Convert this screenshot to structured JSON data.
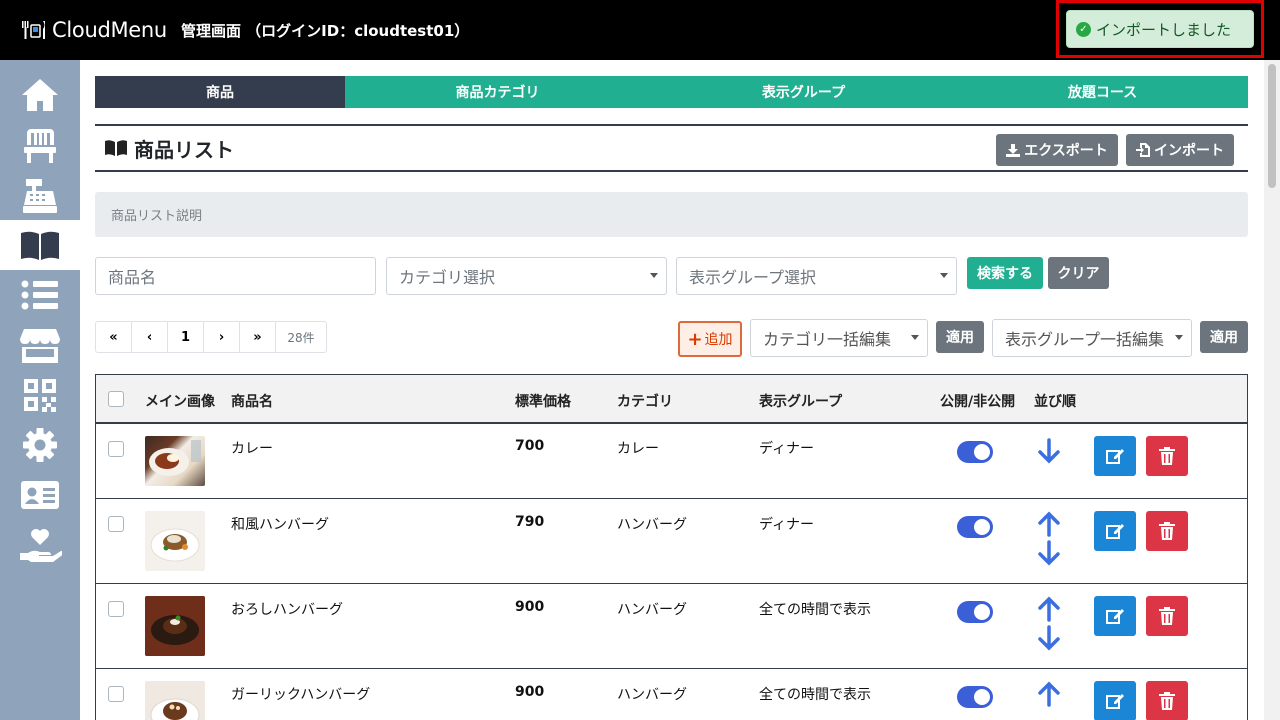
{
  "header": {
    "logo_text": "CloudMenu",
    "admin_title": "管理画面 （ログインID：cloudtest01）"
  },
  "toast": {
    "message": "インポートしました",
    "icon": "check-circle-icon",
    "color": "#28a745"
  },
  "sidebar": {
    "items": [
      {
        "icon": "home-icon"
      },
      {
        "icon": "chair-icon"
      },
      {
        "icon": "cash-register-icon"
      },
      {
        "icon": "book-open-icon",
        "active": true
      },
      {
        "icon": "list-icon"
      },
      {
        "icon": "store-icon"
      },
      {
        "icon": "qrcode-icon"
      },
      {
        "icon": "gear-icon"
      },
      {
        "icon": "id-card-icon"
      },
      {
        "icon": "hand-holding-heart-icon"
      }
    ]
  },
  "tabs": [
    {
      "label": "商品",
      "active": true
    },
    {
      "label": "商品カテゴリ"
    },
    {
      "label": "表示グループ"
    },
    {
      "label": "放題コース"
    }
  ],
  "list": {
    "title": "商品リスト",
    "export_label": "エクスポート",
    "import_label": "インポート",
    "description": "商品リスト説明"
  },
  "search": {
    "name_placeholder": "商品名",
    "category_placeholder": "カテゴリ選択",
    "group_placeholder": "表示グループ選択",
    "search_label": "検索する",
    "clear_label": "クリア"
  },
  "pager": {
    "first": "«",
    "prev": "‹",
    "page": "1",
    "next": "›",
    "last": "»",
    "count": "28件"
  },
  "bulk": {
    "add_label": "追加",
    "category_edit": "カテゴリ一括編集",
    "apply1": "適用",
    "group_edit": "表示グループ一括編集",
    "apply2": "適用"
  },
  "table": {
    "headers": {
      "image": "メイン画像",
      "name": "商品名",
      "price": "標準価格",
      "category": "カテゴリ",
      "group": "表示グループ",
      "public": "公開/非公開",
      "order": "並び順"
    },
    "rows": [
      {
        "name": "カレー",
        "price": "700",
        "category": "カレー",
        "group": "ディナー",
        "published": true,
        "order_arrows": "down"
      },
      {
        "name": "和風ハンバーグ",
        "price": "790",
        "category": "ハンバーグ",
        "group": "ディナー",
        "published": true,
        "order_arrows": "up-down"
      },
      {
        "name": "おろしハンバーグ",
        "price": "900",
        "category": "ハンバーグ",
        "group": "全ての時間で表示",
        "published": true,
        "order_arrows": "up-down"
      },
      {
        "name": "ガーリックハンバーグ",
        "price": "900",
        "category": "ハンバーグ",
        "group": "全ての時間で表示",
        "published": true,
        "order_arrows": "up-down"
      }
    ]
  }
}
